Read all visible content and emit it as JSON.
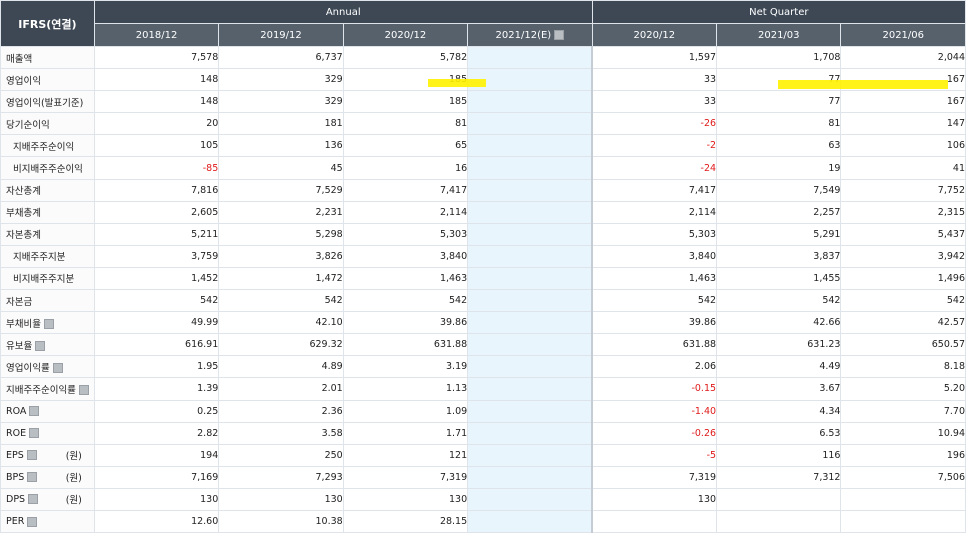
{
  "header": {
    "corner": "IFRS(연결)",
    "groups": [
      "Annual",
      "Net Quarter"
    ],
    "periods": [
      "2018/12",
      "2019/12",
      "2020/12",
      "2021/12(E)",
      "2020/12",
      "2021/03",
      "2021/06"
    ]
  },
  "colors": {
    "header_bg": "#3d4854",
    "subheader_bg": "#56616c",
    "negative": "#e01a1a",
    "estimate_bg": "#e9f5fc",
    "highlight": "#fff200"
  },
  "rows": [
    {
      "label": "매출액",
      "unit": "",
      "help": false,
      "indent": false,
      "values": [
        "7,578",
        "6,737",
        "5,782",
        "",
        "1,597",
        "1,708",
        "2,044"
      ]
    },
    {
      "label": "영업이익",
      "unit": "",
      "help": false,
      "indent": false,
      "values": [
        "148",
        "329",
        "185",
        "",
        "33",
        "77",
        "167"
      ]
    },
    {
      "label": "영업이익(발표기준)",
      "unit": "",
      "help": false,
      "indent": false,
      "values": [
        "148",
        "329",
        "185",
        "",
        "33",
        "77",
        "167"
      ]
    },
    {
      "label": "당기순이익",
      "unit": "",
      "help": false,
      "indent": false,
      "values": [
        "20",
        "181",
        "81",
        "",
        "-26",
        "81",
        "147"
      ]
    },
    {
      "label": "지배주주순이익",
      "unit": "",
      "help": false,
      "indent": true,
      "values": [
        "105",
        "136",
        "65",
        "",
        "-2",
        "63",
        "106"
      ]
    },
    {
      "label": "비지배주주순이익",
      "unit": "",
      "help": false,
      "indent": true,
      "values": [
        "-85",
        "45",
        "16",
        "",
        "-24",
        "19",
        "41"
      ]
    },
    {
      "label": "자산총계",
      "unit": "",
      "help": false,
      "indent": false,
      "values": [
        "7,816",
        "7,529",
        "7,417",
        "",
        "7,417",
        "7,549",
        "7,752"
      ]
    },
    {
      "label": "부채총계",
      "unit": "",
      "help": false,
      "indent": false,
      "values": [
        "2,605",
        "2,231",
        "2,114",
        "",
        "2,114",
        "2,257",
        "2,315"
      ]
    },
    {
      "label": "자본총계",
      "unit": "",
      "help": false,
      "indent": false,
      "values": [
        "5,211",
        "5,298",
        "5,303",
        "",
        "5,303",
        "5,291",
        "5,437"
      ]
    },
    {
      "label": "지배주주지분",
      "unit": "",
      "help": false,
      "indent": true,
      "values": [
        "3,759",
        "3,826",
        "3,840",
        "",
        "3,840",
        "3,837",
        "3,942"
      ]
    },
    {
      "label": "비지배주주지분",
      "unit": "",
      "help": false,
      "indent": true,
      "values": [
        "1,452",
        "1,472",
        "1,463",
        "",
        "1,463",
        "1,455",
        "1,496"
      ]
    },
    {
      "label": "자본금",
      "unit": "",
      "help": false,
      "indent": false,
      "values": [
        "542",
        "542",
        "542",
        "",
        "542",
        "542",
        "542"
      ]
    },
    {
      "label": "부채비율",
      "unit": "",
      "help": true,
      "indent": false,
      "values": [
        "49.99",
        "42.10",
        "39.86",
        "",
        "39.86",
        "42.66",
        "42.57"
      ]
    },
    {
      "label": "유보율",
      "unit": "",
      "help": true,
      "indent": false,
      "values": [
        "616.91",
        "629.32",
        "631.88",
        "",
        "631.88",
        "631.23",
        "650.57"
      ]
    },
    {
      "label": "영업이익률",
      "unit": "",
      "help": true,
      "indent": false,
      "values": [
        "1.95",
        "4.89",
        "3.19",
        "",
        "2.06",
        "4.49",
        "8.18"
      ]
    },
    {
      "label": "지배주주순이익률",
      "unit": "",
      "help": true,
      "indent": false,
      "values": [
        "1.39",
        "2.01",
        "1.13",
        "",
        "-0.15",
        "3.67",
        "5.20"
      ]
    },
    {
      "label": "ROA",
      "unit": "",
      "help": true,
      "indent": false,
      "values": [
        "0.25",
        "2.36",
        "1.09",
        "",
        "-1.40",
        "4.34",
        "7.70"
      ]
    },
    {
      "label": "ROE",
      "unit": "",
      "help": true,
      "indent": false,
      "values": [
        "2.82",
        "3.58",
        "1.71",
        "",
        "-0.26",
        "6.53",
        "10.94"
      ]
    },
    {
      "label": "EPS",
      "unit": "(원)",
      "help": true,
      "indent": false,
      "values": [
        "194",
        "250",
        "121",
        "",
        "-5",
        "116",
        "196"
      ]
    },
    {
      "label": "BPS",
      "unit": "(원)",
      "help": true,
      "indent": false,
      "values": [
        "7,169",
        "7,293",
        "7,319",
        "",
        "7,319",
        "7,312",
        "7,506"
      ]
    },
    {
      "label": "DPS",
      "unit": "(원)",
      "help": true,
      "indent": false,
      "values": [
        "130",
        "130",
        "130",
        "",
        "130",
        "",
        ""
      ]
    },
    {
      "label": "PER",
      "unit": "",
      "help": true,
      "indent": false,
      "values": [
        "12.60",
        "10.38",
        "28.15",
        "",
        "",
        "",
        ""
      ]
    }
  ]
}
